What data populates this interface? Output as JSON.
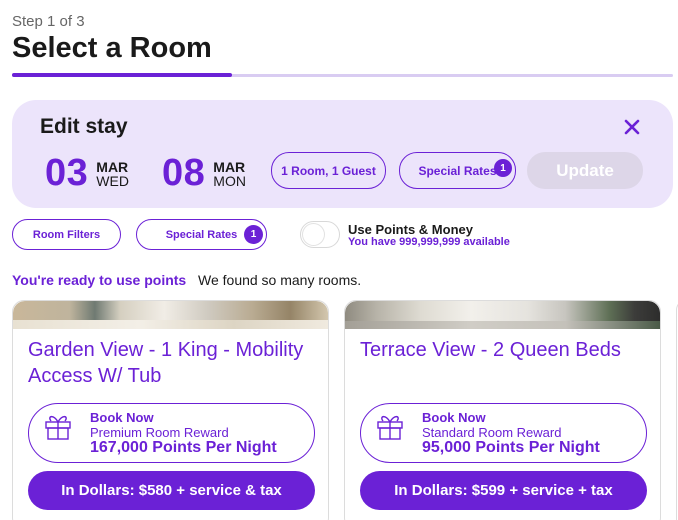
{
  "header": {
    "step": "Step 1 of 3",
    "title": "Select a Room",
    "progress_fraction": 0.333
  },
  "edit_stay": {
    "title": "Edit stay",
    "check_in": {
      "day": "03",
      "month": "MAR",
      "weekday": "WED"
    },
    "check_out": {
      "day": "08",
      "month": "MAR",
      "weekday": "MON"
    },
    "rooms_guests": "1 Room, 1 Guest",
    "special_rates": {
      "label": "Special Rates",
      "badge": "1"
    },
    "update_label": "Update"
  },
  "filters": {
    "room_filters": "Room Filters",
    "special_rates": {
      "label": "Special Rates",
      "badge": "1"
    },
    "points_toggle": {
      "title": "Use Points & Money",
      "subtitle": "You have 999,999,999 available",
      "on": false
    }
  },
  "results": {
    "ready_text": "You're ready to use points",
    "found_text": "We found so many rooms."
  },
  "rooms": [
    {
      "name": "Garden View - 1 King - Mobility Access W/ Tub",
      "reward_title": "Book Now",
      "reward_type": "Premium Room Reward",
      "reward_points": "167,000 Points Per Night",
      "dollars": "In Dollars: $580 + service & tax"
    },
    {
      "name": "Terrace View - 2 Queen Beds",
      "reward_title": "Book Now",
      "reward_type": "Standard Room Reward",
      "reward_points": "95,000 Points Per Night",
      "dollars": "In Dollars: $599 + service + tax"
    }
  ],
  "colors": {
    "accent": "#6b21d6",
    "panel_bg": "#ece4fb",
    "update_disabled": "#ddd6e8"
  },
  "icons": [
    "close-icon",
    "gift-icon"
  ]
}
